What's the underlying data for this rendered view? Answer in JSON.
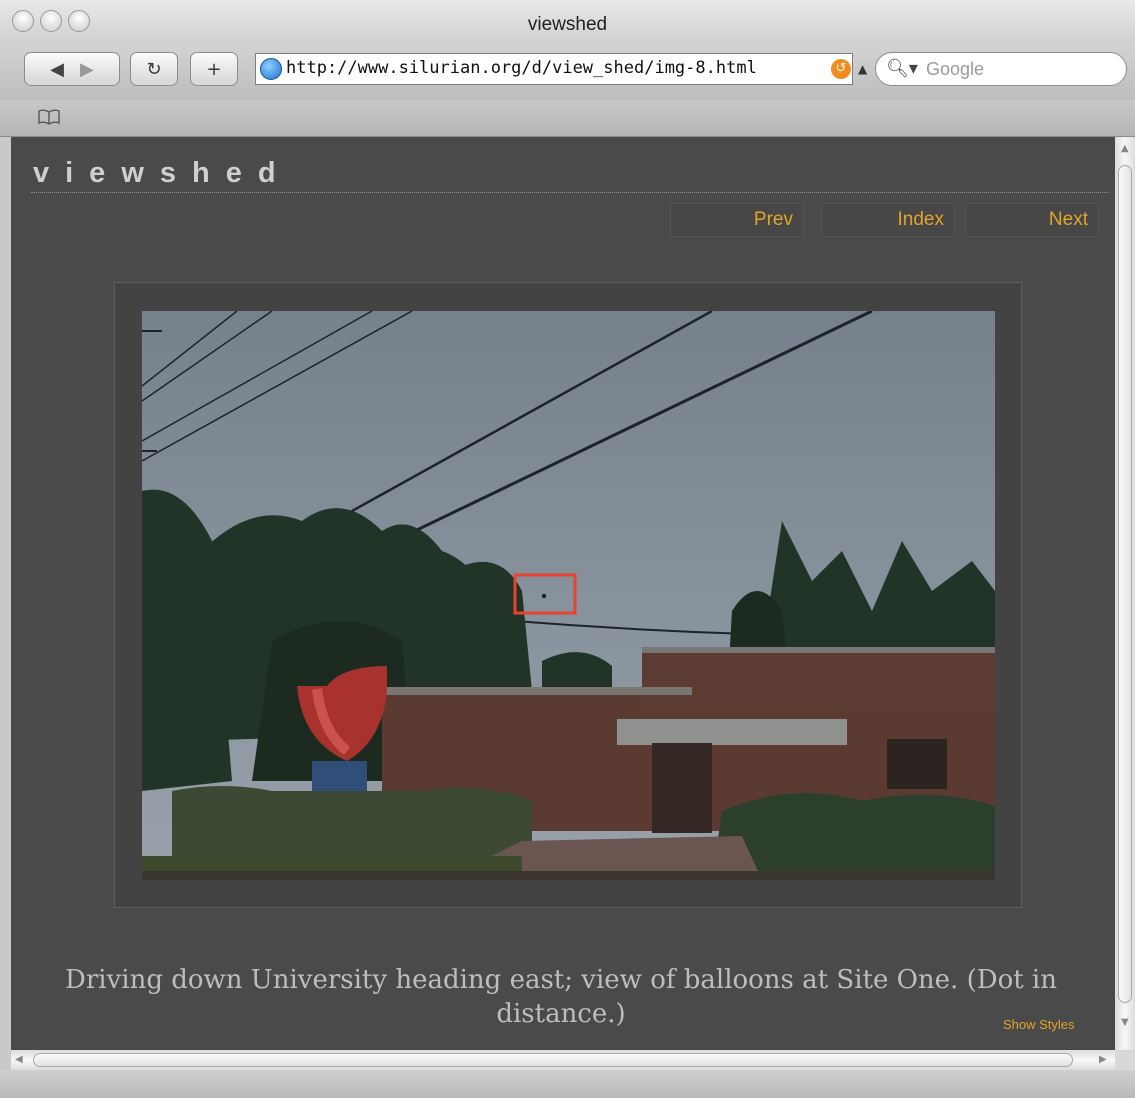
{
  "window": {
    "title": "viewshed"
  },
  "toolbar": {
    "url": "http://www.silurian.org/d/view_shed/img-8.html",
    "search_placeholder": "Google",
    "reload_glyph": "↻",
    "add_glyph": "+"
  },
  "page": {
    "site_title": "viewshed",
    "nav": {
      "prev": "Prev",
      "index": "Index",
      "next": "Next"
    },
    "caption": "Driving down University heading east; view of balloons at Site One. (Dot in distance.)",
    "show_styles": "Show Styles"
  },
  "colors": {
    "page_bg": "#4a4a4a",
    "nav_link": "#e1a42b",
    "highlight_box": "#e8432f"
  },
  "icons": [
    "back-icon",
    "forward-icon",
    "reload-icon",
    "add-bookmark-icon",
    "globe-icon",
    "rss-icon",
    "search-icon",
    "bookmarks-book-icon"
  ]
}
